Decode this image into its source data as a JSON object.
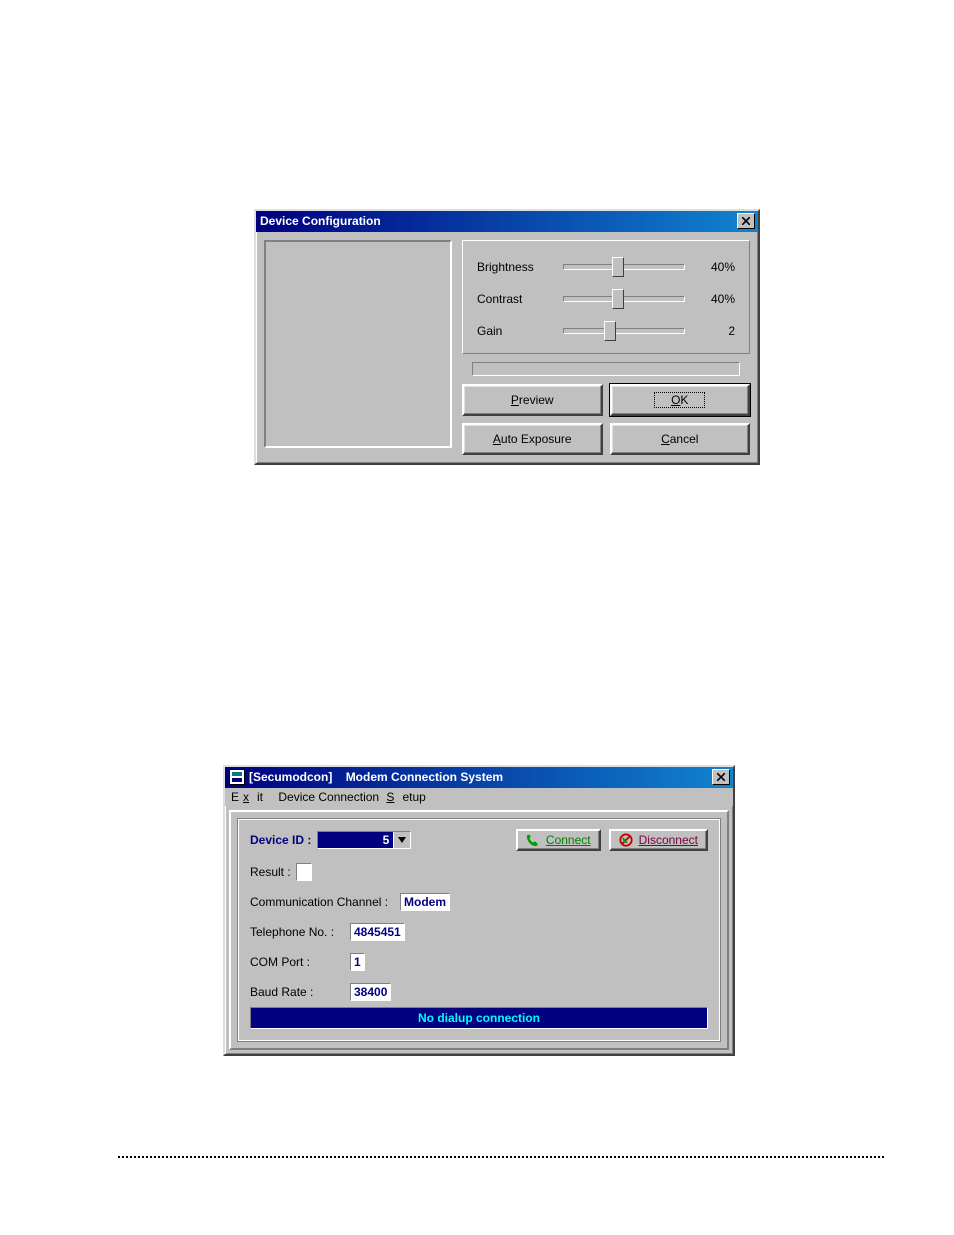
{
  "dlg1": {
    "title": "Device Configuration",
    "sliders": {
      "brightness": {
        "label": "Brightness",
        "value": 40,
        "display": "40%"
      },
      "contrast": {
        "label": "Contrast",
        "value": 40,
        "display": "40%"
      },
      "gain": {
        "label": "Gain",
        "value": 33,
        "display": "2"
      }
    },
    "buttons": {
      "preview": "Preview",
      "ok": "OK",
      "auto_exposure": "Auto Exposure",
      "cancel": "Cancel"
    }
  },
  "dlg2": {
    "title_app": "[Secumodcon]",
    "title_rest": "Modem Connection System",
    "menu": {
      "exit": "Exit",
      "setup": "Device Connection Setup"
    },
    "device_id_label": "Device ID :",
    "device_id_value": "5",
    "connect_label": "Connect",
    "disconnect_label": "Disconnect",
    "result_label": "Result :",
    "result_value": "",
    "comm_label": "Communication Channel :",
    "comm_value": "Modem",
    "tel_label": "Telephone No. :",
    "tel_value": "4845451",
    "com_label": "COM Port :",
    "com_value": "1",
    "baud_label": "Baud Rate :",
    "baud_value": "38400",
    "status": "No dialup connection"
  }
}
